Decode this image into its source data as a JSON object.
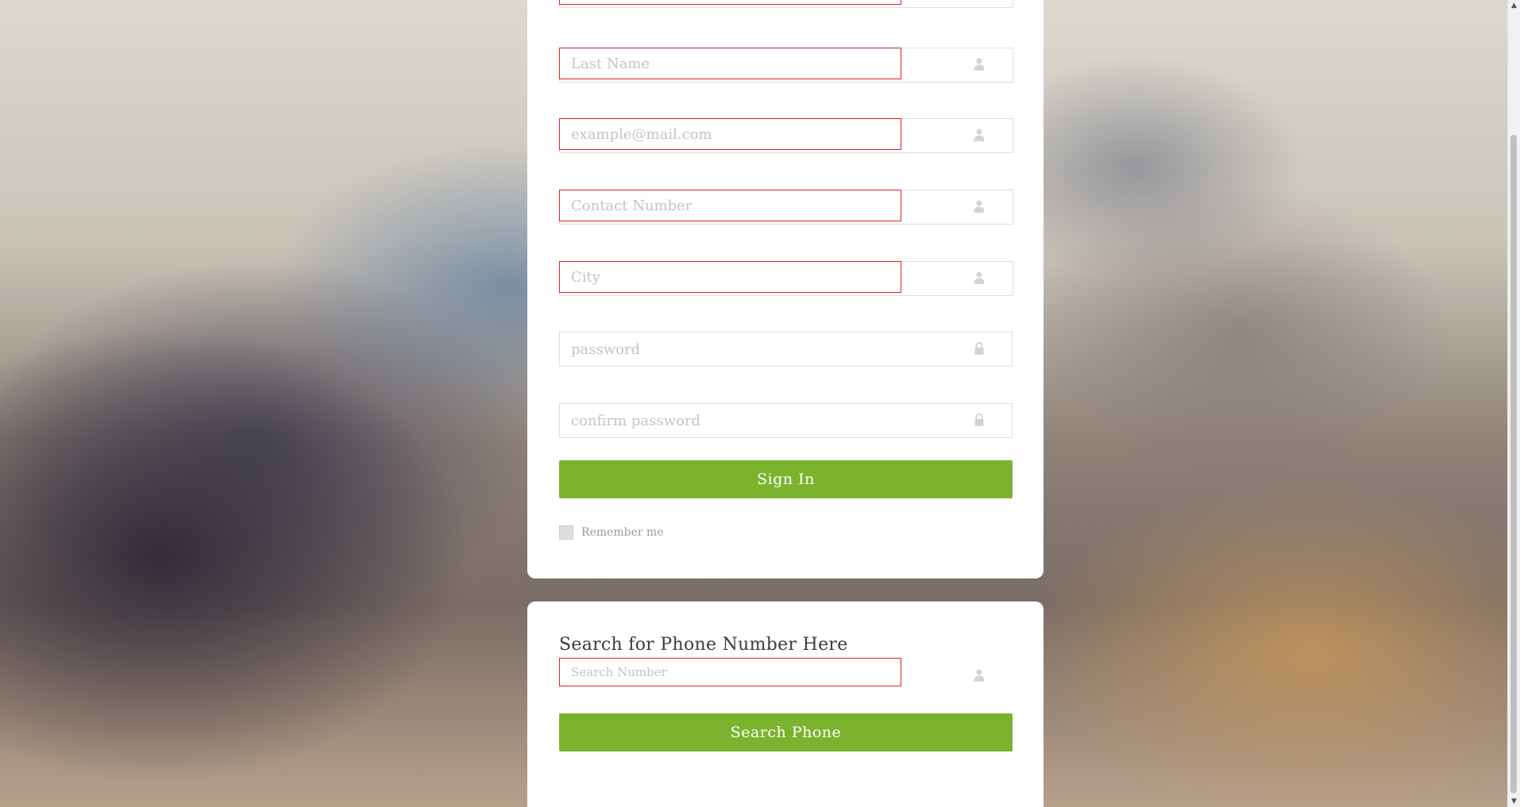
{
  "signup": {
    "fields": [
      {
        "placeholder": "",
        "icon": "user-icon"
      },
      {
        "placeholder": "Last Name",
        "icon": "user-icon"
      },
      {
        "placeholder": "example@mail.com",
        "icon": "user-icon"
      },
      {
        "placeholder": "Contact Number",
        "icon": "user-icon"
      },
      {
        "placeholder": "City",
        "icon": "user-icon"
      },
      {
        "placeholder": "password",
        "icon": "lock-icon"
      },
      {
        "placeholder": "confirm password",
        "icon": "lock-icon"
      }
    ],
    "submit_label": "Sign In",
    "remember_label": "Remember me"
  },
  "search": {
    "title": "Search for Phone Number Here",
    "placeholder": "Search Number",
    "icon": "user-icon",
    "button_label": "Search Phone"
  },
  "colors": {
    "accent": "#7cb32e",
    "error_border": "#e31e24"
  }
}
